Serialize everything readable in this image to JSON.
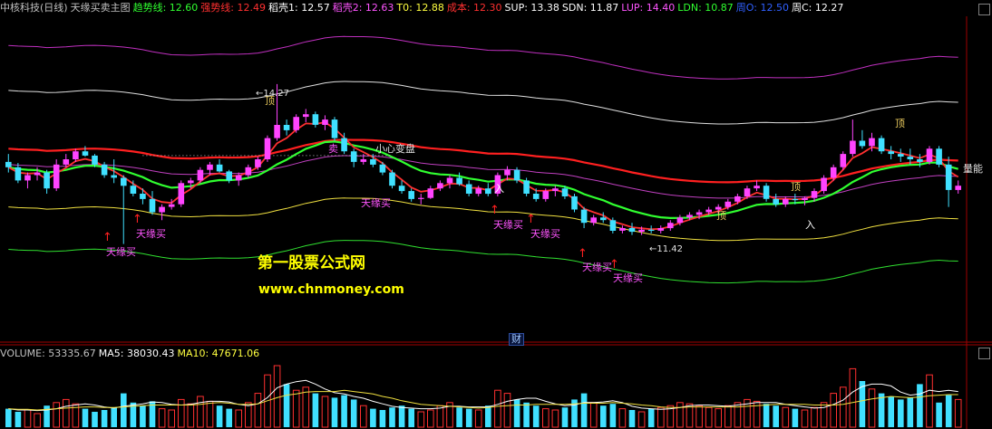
{
  "header": {
    "items": [
      {
        "label": "中核科技(日线)",
        "color": "#c0c0c0"
      },
      {
        "label": "天缘买卖主图",
        "color": "#c0c0c0"
      },
      {
        "label": "趋势线: 12.60",
        "color": "#30ff30"
      },
      {
        "label": "强势线: 12.49",
        "color": "#ff3030"
      },
      {
        "label": "稻壳1: 12.57",
        "color": "#ffffff"
      },
      {
        "label": "稻壳2: 12.63",
        "color": "#ff55ff"
      },
      {
        "label": "T0: 12.88",
        "color": "#ffff40"
      },
      {
        "label": "成本: 12.30",
        "color": "#ff3030"
      },
      {
        "label": "SUP: 13.38",
        "color": "#ffffff"
      },
      {
        "label": "SDN: 11.87",
        "color": "#ffffff"
      },
      {
        "label": "LUP: 14.40",
        "color": "#ff55ff"
      },
      {
        "label": "LDN: 10.87",
        "color": "#30ff30"
      },
      {
        "label": "周O: 12.50",
        "color": "#3060ff"
      },
      {
        "label": "周C: 12.27",
        "color": "#ffffff"
      }
    ]
  },
  "volume_header": {
    "items": [
      {
        "label": "VOLUME: 53335.67",
        "color": "#c0c0c0"
      },
      {
        "label": "MA5: 38030.43",
        "color": "#ffffff"
      },
      {
        "label": "MA10: 47671.06",
        "color": "#ffff40"
      }
    ]
  },
  "annotations": {
    "high_label": "←14.27",
    "low_label": "←11.42",
    "buy_label": "天缘买",
    "top_label": "顶",
    "in_label": "入",
    "sell_label": "卖",
    "warning_label": "小心变盘",
    "volume_tag": "量能",
    "finance_tag": "财"
  },
  "watermark": {
    "line1": "第一股票公式网",
    "line2": "www.chnmoney.com"
  },
  "colors": {
    "up": "#ff44ff",
    "down": "#40e0ff",
    "up_strong": "#ff3030",
    "down_strong": "#30ff30",
    "trend": "#30ff30",
    "strong": "#ff3030",
    "magenta": "#ff55ff"
  },
  "chart_data": {
    "type": "candlestick",
    "ylim": [
      9.5,
      15.55
    ],
    "x_count": 100,
    "candles": [
      [
        12.8,
        12.95,
        12.6,
        12.7
      ],
      [
        12.7,
        12.78,
        12.4,
        12.45
      ],
      [
        12.45,
        12.6,
        12.3,
        12.55
      ],
      [
        12.55,
        12.7,
        12.45,
        12.6
      ],
      [
        12.6,
        12.65,
        12.2,
        12.3
      ],
      [
        12.3,
        12.85,
        12.25,
        12.75
      ],
      [
        12.75,
        12.95,
        12.7,
        12.85
      ],
      [
        12.85,
        13.05,
        12.8,
        13.0
      ],
      [
        13.0,
        13.1,
        12.9,
        12.92
      ],
      [
        12.92,
        12.95,
        12.7,
        12.75
      ],
      [
        12.75,
        12.8,
        12.5,
        12.55
      ],
      [
        12.55,
        12.85,
        12.4,
        12.5
      ],
      [
        12.5,
        12.55,
        11.25,
        12.35
      ],
      [
        12.35,
        12.45,
        12.15,
        12.2
      ],
      [
        12.2,
        12.3,
        12.0,
        12.1
      ],
      [
        12.1,
        12.25,
        11.8,
        11.85
      ],
      [
        11.85,
        12.0,
        11.7,
        11.95
      ],
      [
        11.95,
        12.1,
        11.9,
        12.0
      ],
      [
        12.0,
        12.45,
        11.95,
        12.4
      ],
      [
        12.4,
        12.5,
        12.3,
        12.45
      ],
      [
        12.45,
        12.7,
        12.4,
        12.65
      ],
      [
        12.65,
        12.8,
        12.55,
        12.75
      ],
      [
        12.75,
        12.85,
        12.6,
        12.62
      ],
      [
        12.62,
        12.65,
        12.4,
        12.45
      ],
      [
        12.45,
        12.6,
        12.35,
        12.55
      ],
      [
        12.55,
        12.75,
        12.5,
        12.7
      ],
      [
        12.7,
        12.9,
        12.65,
        12.85
      ],
      [
        12.85,
        13.3,
        12.8,
        13.25
      ],
      [
        13.25,
        14.27,
        13.2,
        13.5
      ],
      [
        13.5,
        13.6,
        13.3,
        13.4
      ],
      [
        13.4,
        13.7,
        13.35,
        13.65
      ],
      [
        13.65,
        13.8,
        13.55,
        13.7
      ],
      [
        13.7,
        13.75,
        13.45,
        13.5
      ],
      [
        13.5,
        13.68,
        13.4,
        13.6
      ],
      [
        13.6,
        13.65,
        13.2,
        13.25
      ],
      [
        13.25,
        13.35,
        12.95,
        13.0
      ],
      [
        13.0,
        13.05,
        12.7,
        12.8
      ],
      [
        12.8,
        12.95,
        12.75,
        12.85
      ],
      [
        12.85,
        12.95,
        12.7,
        12.75
      ],
      [
        12.75,
        12.8,
        12.55,
        12.6
      ],
      [
        12.6,
        12.65,
        12.3,
        12.35
      ],
      [
        12.35,
        12.45,
        12.2,
        12.25
      ],
      [
        12.25,
        12.3,
        12.05,
        12.1
      ],
      [
        12.1,
        12.2,
        12.0,
        12.12
      ],
      [
        12.12,
        12.35,
        12.1,
        12.3
      ],
      [
        12.3,
        12.45,
        12.25,
        12.4
      ],
      [
        12.4,
        12.55,
        12.3,
        12.5
      ],
      [
        12.5,
        12.6,
        12.35,
        12.38
      ],
      [
        12.38,
        12.45,
        12.15,
        12.2
      ],
      [
        12.2,
        12.35,
        12.15,
        12.3
      ],
      [
        12.3,
        12.4,
        12.15,
        12.2
      ],
      [
        12.2,
        12.6,
        12.15,
        12.55
      ],
      [
        12.55,
        12.72,
        12.45,
        12.65
      ],
      [
        12.65,
        12.7,
        12.4,
        12.45
      ],
      [
        12.45,
        12.5,
        12.15,
        12.2
      ],
      [
        12.2,
        12.3,
        12.05,
        12.1
      ],
      [
        12.1,
        12.3,
        12.05,
        12.25
      ],
      [
        12.25,
        12.35,
        12.15,
        12.3
      ],
      [
        12.3,
        12.35,
        12.1,
        12.15
      ],
      [
        12.15,
        12.2,
        11.85,
        11.9
      ],
      [
        11.9,
        11.95,
        11.55,
        11.65
      ],
      [
        11.65,
        11.8,
        11.6,
        11.75
      ],
      [
        11.75,
        11.85,
        11.65,
        11.7
      ],
      [
        11.7,
        11.75,
        11.45,
        11.5
      ],
      [
        11.5,
        11.6,
        11.45,
        11.55
      ],
      [
        11.55,
        11.65,
        11.42,
        11.48
      ],
      [
        11.48,
        11.58,
        11.42,
        11.52
      ],
      [
        11.52,
        11.6,
        11.45,
        11.5
      ],
      [
        11.5,
        11.6,
        11.45,
        11.55
      ],
      [
        11.55,
        11.7,
        11.5,
        11.65
      ],
      [
        11.65,
        11.8,
        11.6,
        11.75
      ],
      [
        11.75,
        11.85,
        11.7,
        11.8
      ],
      [
        11.8,
        11.9,
        11.72,
        11.85
      ],
      [
        11.85,
        11.95,
        11.8,
        11.9
      ],
      [
        11.9,
        12.0,
        11.82,
        11.95
      ],
      [
        11.95,
        12.1,
        11.9,
        12.05
      ],
      [
        12.05,
        12.2,
        12.0,
        12.15
      ],
      [
        12.15,
        12.35,
        12.1,
        12.3
      ],
      [
        12.3,
        12.45,
        12.25,
        12.35
      ],
      [
        12.35,
        12.4,
        12.05,
        12.1
      ],
      [
        12.1,
        12.2,
        11.95,
        12.0
      ],
      [
        12.0,
        12.15,
        11.95,
        12.1
      ],
      [
        12.1,
        12.2,
        12.0,
        12.08
      ],
      [
        12.08,
        12.15,
        11.98,
        12.12
      ],
      [
        12.12,
        12.3,
        12.05,
        12.25
      ],
      [
        12.25,
        12.55,
        12.2,
        12.5
      ],
      [
        12.5,
        12.75,
        12.45,
        12.7
      ],
      [
        12.7,
        13.0,
        12.65,
        12.95
      ],
      [
        12.95,
        13.6,
        12.9,
        13.2
      ],
      [
        13.2,
        13.4,
        13.05,
        13.1
      ],
      [
        13.1,
        13.35,
        13.0,
        13.25
      ],
      [
        13.25,
        13.3,
        12.95,
        13.0
      ],
      [
        13.0,
        13.1,
        12.85,
        12.95
      ],
      [
        12.95,
        13.05,
        12.8,
        12.9
      ],
      [
        12.9,
        13.05,
        12.75,
        12.85
      ],
      [
        12.85,
        12.95,
        12.7,
        12.8
      ],
      [
        12.8,
        13.1,
        12.75,
        13.05
      ],
      [
        13.05,
        13.1,
        12.7,
        12.75
      ],
      [
        12.75,
        12.9,
        11.95,
        12.27
      ],
      [
        12.27,
        12.45,
        12.2,
        12.35
      ]
    ],
    "volume": [
      30,
      25,
      28,
      22,
      35,
      40,
      45,
      38,
      30,
      25,
      28,
      32,
      55,
      40,
      35,
      42,
      30,
      28,
      45,
      38,
      50,
      42,
      35,
      30,
      28,
      40,
      55,
      85,
      100,
      70,
      60,
      65,
      55,
      50,
      48,
      52,
      45,
      35,
      30,
      28,
      32,
      35,
      30,
      25,
      28,
      35,
      40,
      32,
      30,
      28,
      35,
      60,
      55,
      45,
      40,
      35,
      30,
      28,
      32,
      45,
      55,
      40,
      35,
      38,
      30,
      28,
      25,
      30,
      32,
      35,
      40,
      38,
      35,
      32,
      30,
      35,
      40,
      45,
      42,
      38,
      35,
      32,
      30,
      28,
      32,
      40,
      55,
      65,
      95,
      75,
      62,
      55,
      50,
      45,
      48,
      70,
      85,
      40,
      52,
      45
    ],
    "ma5_vol": [
      30,
      28,
      28,
      27,
      28,
      30,
      34,
      36,
      38,
      36,
      33,
      31,
      34,
      36,
      38,
      41,
      40,
      37,
      36,
      37,
      40,
      42,
      42,
      41,
      37,
      35,
      38,
      48,
      64,
      70,
      74,
      76,
      70,
      62,
      56,
      54,
      50,
      47,
      42,
      38,
      34,
      32,
      31,
      30,
      30,
      31,
      34,
      34,
      33,
      33,
      33,
      37,
      42,
      45,
      47,
      47,
      42,
      38,
      35,
      36,
      40,
      40,
      41,
      43,
      40,
      34,
      31,
      30,
      29,
      30,
      32,
      35,
      36,
      36,
      35,
      34,
      36,
      38,
      40,
      40,
      40,
      37,
      35,
      33,
      31,
      32,
      37,
      44,
      57,
      66,
      70,
      70,
      67,
      57,
      52,
      54,
      60,
      58,
      60,
      58
    ],
    "ma10_vol": [
      30,
      29,
      29,
      28,
      29,
      30,
      31,
      32,
      33,
      33,
      32,
      32,
      33,
      34,
      35,
      36,
      36,
      36,
      36,
      36,
      37,
      39,
      40,
      39,
      37,
      37,
      38,
      43,
      48,
      52,
      54,
      57,
      58,
      58,
      58,
      60,
      58,
      56,
      54,
      50,
      47,
      43,
      40,
      37,
      36,
      35,
      34,
      33,
      32,
      31,
      32,
      34,
      35,
      36,
      36,
      37,
      37,
      37,
      37,
      38,
      39,
      39,
      39,
      40,
      39,
      38,
      36,
      35,
      33,
      32,
      32,
      33,
      33,
      33,
      33,
      33,
      33,
      34,
      35,
      36,
      37,
      37,
      37,
      37,
      36,
      36,
      36,
      37,
      40,
      43,
      46,
      48,
      50,
      49,
      48,
      49,
      51,
      52,
      53,
      53
    ]
  }
}
